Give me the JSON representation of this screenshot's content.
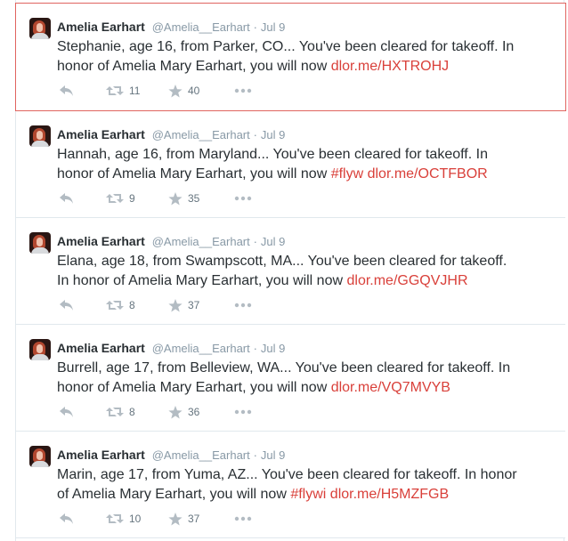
{
  "colors": {
    "link": "#d9403a",
    "muted": "#8899a6",
    "border": "#e1e8ed",
    "selected_border": "#e0645f"
  },
  "tweets": [
    {
      "name": "Amelia Earhart",
      "handle": "@Amelia__Earhart",
      "separator": "·",
      "time": "Jul 9",
      "text_line1": "Stephanie, age 16, from Parker, CO... You've been cleared for takeoff. In",
      "text_line2_prefix": "honor of Amelia Mary Earhart, you will now ",
      "hashtag": "",
      "link": " dlor.me/HXTROHJ",
      "retweets": "11",
      "favorites": "40",
      "selected": true
    },
    {
      "name": "Amelia Earhart",
      "handle": "@Amelia__Earhart",
      "separator": "·",
      "time": "Jul 9",
      "text_line1": "Hannah, age 16, from Maryland... You've been cleared for takeoff. In",
      "text_line2_prefix": "honor of Amelia Mary Earhart, you will now ",
      "hashtag": "#flyw",
      "link": " dlor.me/OCTFBOR",
      "retweets": "9",
      "favorites": "35",
      "selected": false
    },
    {
      "name": "Amelia Earhart",
      "handle": "@Amelia__Earhart",
      "separator": "·",
      "time": "Jul 9",
      "text_line1": "Elana, age 18, from Swampscott, MA... You've been cleared for takeoff.",
      "text_line2_prefix": "In honor of Amelia Mary Earhart, you will now ",
      "hashtag": "",
      "link": " dlor.me/GGQVJHR",
      "retweets": "8",
      "favorites": "37",
      "selected": false
    },
    {
      "name": "Amelia Earhart",
      "handle": "@Amelia__Earhart",
      "separator": "·",
      "time": "Jul 9",
      "text_line1": "Burrell, age 17, from Belleview, WA... You've been cleared for takeoff. In",
      "text_line2_prefix": "honor of Amelia Mary Earhart, you will now ",
      "hashtag": "",
      "link": "dlor.me/VQ7MVYB",
      "retweets": "8",
      "favorites": "36",
      "selected": false
    },
    {
      "name": "Amelia Earhart",
      "handle": "@Amelia__Earhart",
      "separator": "·",
      "time": "Jul 9",
      "text_line1": "Marin, age 17, from Yuma, AZ... You've been cleared for takeoff. In honor",
      "text_line2_prefix": "of Amelia Mary Earhart, you will now ",
      "hashtag": "#flywi",
      "link": " dlor.me/H5MZFGB",
      "retweets": "10",
      "favorites": "37",
      "selected": false
    }
  ]
}
